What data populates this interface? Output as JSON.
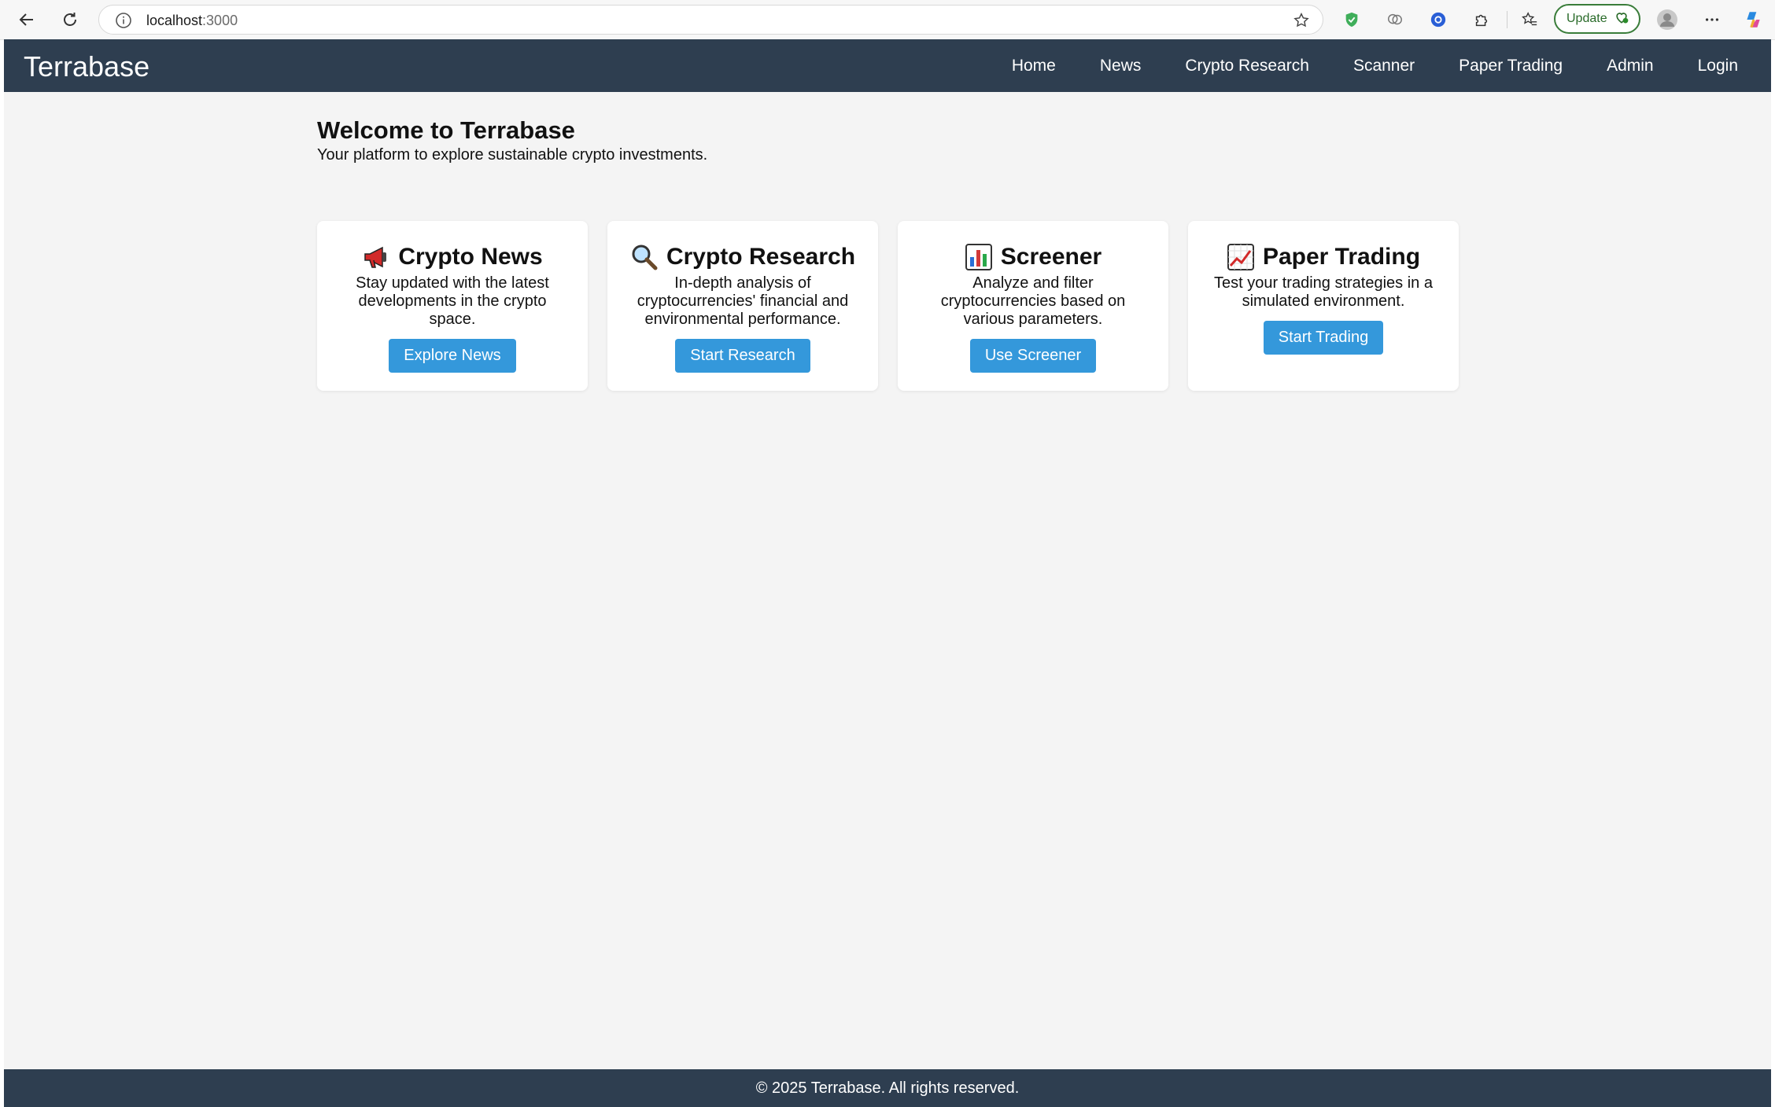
{
  "browser": {
    "url_host": "localhost",
    "url_port": ":3000",
    "update_label": "Update",
    "icons": [
      "back-icon",
      "reload-icon",
      "site-info-icon",
      "star-icon",
      "shield-icon",
      "brain-icon",
      "extension-badge-icon",
      "puzzle-icon",
      "favorites-icon",
      "profile-avatar-icon",
      "more-icon",
      "copilot-icon"
    ]
  },
  "navbar": {
    "brand": "Terrabase",
    "links": [
      "Home",
      "News",
      "Crypto Research",
      "Scanner",
      "Paper Trading",
      "Admin",
      "Login"
    ]
  },
  "hero": {
    "title": "Welcome to Terrabase",
    "subtitle": "Your platform to explore sustainable crypto investments."
  },
  "cards": [
    {
      "icon": "megaphone-icon",
      "title": "Crypto News",
      "desc": "Stay updated with the latest developments in the crypto space.",
      "button": "Explore News"
    },
    {
      "icon": "magnifier-icon",
      "title": "Crypto Research",
      "desc": "In-depth analysis of cryptocurrencies' financial and environmental performance.",
      "button": "Start Research"
    },
    {
      "icon": "bar-chart-icon",
      "title": "Screener",
      "desc": "Analyze and filter cryptocurrencies based on various parameters.",
      "button": "Use Screener"
    },
    {
      "icon": "trend-chart-icon",
      "title": "Paper Trading",
      "desc": "Test your trading strategies in a simulated environment.",
      "button": "Start Trading"
    }
  ],
  "footer": {
    "text": "© 2025 Terrabase. All rights reserved."
  },
  "colors": {
    "navbar": "#2e3e50",
    "button": "#3498db",
    "page_bg": "#f4f4f4"
  }
}
